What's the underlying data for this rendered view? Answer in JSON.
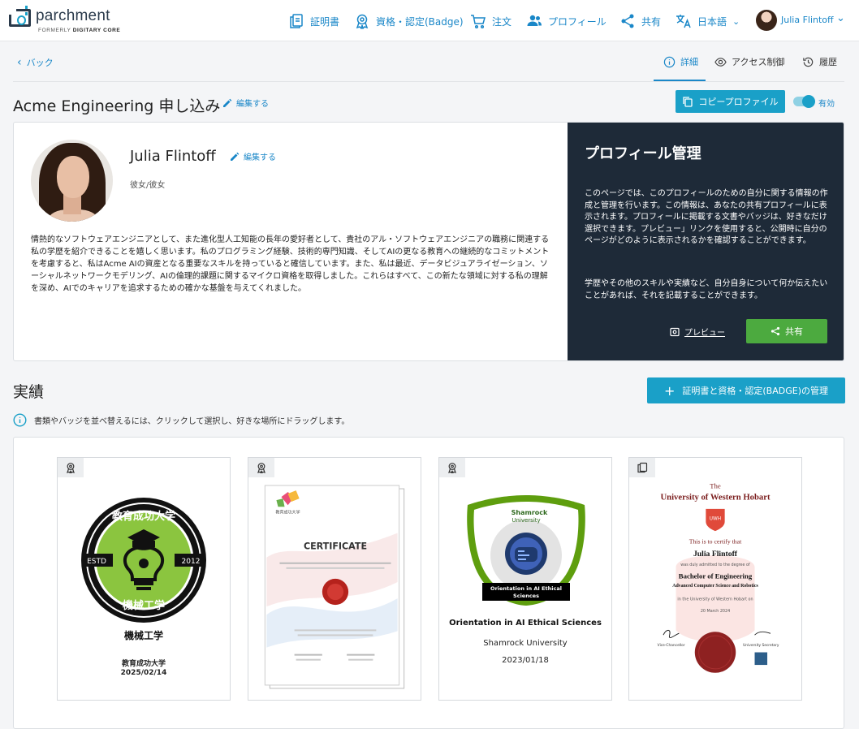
{
  "nav": {
    "logo_text": "parchment",
    "logo_sub_prefix": "FORMERLY",
    "logo_sub_brand": "DIGITARY CORE",
    "items": [
      {
        "label": "証明書"
      },
      {
        "label": "資格・認定(Badge)"
      },
      {
        "label": "注文"
      },
      {
        "label": "プロフィール"
      },
      {
        "label": "共有"
      },
      {
        "label": "日本語"
      }
    ],
    "user": "Julia Flintoff"
  },
  "subnav": {
    "back": "バック",
    "tabs": [
      {
        "label": "詳細",
        "active": true
      },
      {
        "label": "アクセス制御",
        "active": false
      },
      {
        "label": "履歴",
        "active": false
      }
    ]
  },
  "header": {
    "title": "Acme Engineering 申し込み",
    "edit": "編集する",
    "copy_button": "コピープロファイル",
    "toggle_label": "有効",
    "toggle_on": true
  },
  "profile": {
    "name": "Julia Flintoff",
    "edit": "編集する",
    "pronouns": "彼女/彼女",
    "bio": "情熱的なソフトウェアエンジニアとして、また進化型人工知能の長年の愛好者として、貴社のアル・ソフトウェアエンジニアの職務に関連する私の学歴を紹介できることを嬉しく思います。私のプログラミング経験、技術的専門知識、そしてAIの更なる教育への継続的なコミットメントを考慮すると、私はAcme AIの資産となる重要なスキルを持っていると確信しています。また、私は最近、データビジュアライゼーション、ソーシャルネットワークモデリング、AIの倫理的課題に関するマイクロ資格を取得しました。これらはすべて、この新たな領域に対する私の理解を深め、AIでのキャリアを追求するための確かな基盤を与えてくれました。"
  },
  "manage": {
    "title": "プロフィール管理",
    "p1": "このページでは、このプロフィールのための自分に関する情報の作成と管理を行います。この情報は、あなたの共有プロフィールに表示されます。プロフィールに掲載する文書やバッジは、好きなだけ選択できます。プレビュー」リンクを使用すると、公開時に自分のページがどのように表示されるかを確認することができます。",
    "p2": "学歴やその他のスキルや実績など、自分自身について何か伝えたいことがあれば、それを記載することができます。",
    "preview": "プレビュー",
    "share": "共有"
  },
  "achievements": {
    "title": "実績",
    "manage_button": "証明書と資格・認定(BADGE)の管理",
    "hint": "書類やバッジを並べ替えるには、クリックして選択し、好きな場所にドラッグします。",
    "items": [
      {
        "type": "badge-icon",
        "badge_top": "教育成功大学",
        "badge_bottom": "機械工学",
        "estd": "ESTD",
        "year": "2012",
        "name": "機械工学",
        "issuer": "教育成功大学",
        "date": "2025/02/14"
      },
      {
        "type": "badge-icon",
        "cert_label": "CERTIFICATE",
        "cert_logo": "教育成功大学"
      },
      {
        "type": "badge-icon",
        "badge_org_1": "Shamrock",
        "badge_org_2": "University",
        "ribbon_1": "Orientation in AI Ethical",
        "ribbon_2": "Sciences",
        "name": "Orientation in AI Ethical Sciences",
        "issuer": "Shamrock University",
        "date": "2023/01/18"
      },
      {
        "type": "document-icon",
        "doc_the": "The",
        "doc_uni": "University of Western Hobart",
        "doc_crest": "UWH",
        "doc_certify": "This is to certify that",
        "doc_name": "Julia Flintoff",
        "doc_admitted": "was duly admitted to the degree of",
        "doc_degree": "Bachelor of Engineering",
        "doc_major": "Advanced Computer Science and Robotics",
        "doc_place": "in the University of Western Hobart on",
        "doc_date": "20 March 2024",
        "doc_sig1": "Vice-Chancellor",
        "doc_sig2": "University Secretary"
      }
    ]
  },
  "colors": {
    "accent": "#1aa0c8",
    "link": "#1a87c8",
    "dark_panel": "#1e2a38",
    "share_green": "#4caa3f"
  }
}
